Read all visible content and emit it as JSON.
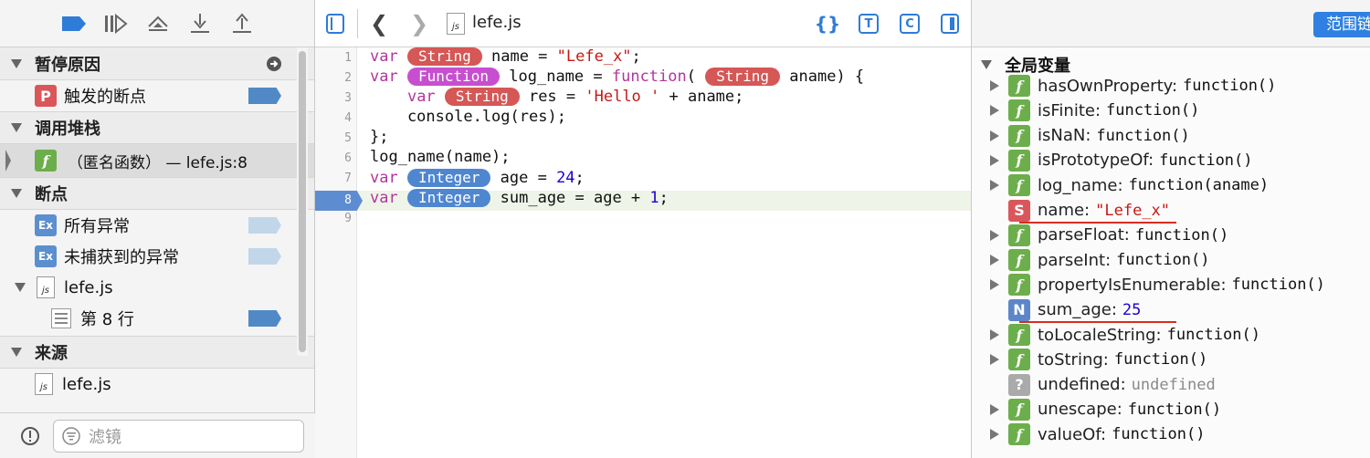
{
  "sidebar": {
    "sections": {
      "pause_reason": "暂停原因",
      "call_stack": "调用堆栈",
      "breakpoints": "断点",
      "sources": "来源"
    },
    "pause_item": {
      "badge": "P",
      "label": "触发的断点"
    },
    "stack_item": {
      "badge": "f",
      "label": "（匿名函数） — lefe.js:8"
    },
    "breakpoint_items": [
      {
        "badge": "Ex",
        "label": "所有异常"
      },
      {
        "badge": "Ex",
        "label": "未捕获到的异常"
      }
    ],
    "bp_file": {
      "icon": "js",
      "label": "lefe.js"
    },
    "bp_line": "第 8 行",
    "source_file": {
      "icon": "js",
      "label": "lefe.js"
    },
    "filter_placeholder": "滤镜"
  },
  "editor": {
    "file_icon": "js",
    "file_name": "lefe.js",
    "toolbar_icons": [
      "{}",
      "T",
      "C"
    ],
    "line_numbers": [
      "1",
      "2",
      "3",
      "4",
      "5",
      "6",
      "7",
      "8",
      "9"
    ],
    "active_line": "8",
    "tokens": {
      "var": "var",
      "function_kw": "function",
      "type_string": "String",
      "type_function": "Function",
      "type_integer": "Integer",
      "l1_rest": " name = ",
      "l1_str": "\"Lefe_x\"",
      "l1_end": ";",
      "l2_a": " log_name = ",
      "l2_b": "( ",
      "l2_c": " aname) {",
      "l3_indent": "    ",
      "l3_rest": " res = ",
      "l3_str": "'Hello '",
      "l3_end": " + aname;",
      "l4": "    console.log(res);",
      "l5": "};",
      "l6": "log_name(name);",
      "l7_rest": " age = ",
      "l7_num": "24",
      "l8_rest": " sum_age = age + ",
      "l8_num": "1",
      "semi": ";"
    }
  },
  "scope": {
    "button": "范围链",
    "section": "全局变量",
    "vars": [
      {
        "badge": "f",
        "name": "hasOwnProperty:",
        "value": "function()",
        "kind": "fn",
        "expandable": true
      },
      {
        "badge": "f",
        "name": "isFinite:",
        "value": "function()",
        "kind": "fn",
        "expandable": true
      },
      {
        "badge": "f",
        "name": "isNaN:",
        "value": "function()",
        "kind": "fn",
        "expandable": true
      },
      {
        "badge": "f",
        "name": "isPrototypeOf:",
        "value": "function()",
        "kind": "fn",
        "expandable": true
      },
      {
        "badge": "f",
        "name": "log_name:",
        "value": "function(aname)",
        "kind": "fn",
        "expandable": true
      },
      {
        "badge": "S",
        "name": "name:",
        "value": "\"Lefe_x\"",
        "kind": "str",
        "expandable": false
      },
      {
        "badge": "f",
        "name": "parseFloat:",
        "value": "function()",
        "kind": "fn",
        "expandable": true
      },
      {
        "badge": "f",
        "name": "parseInt:",
        "value": "function()",
        "kind": "fn",
        "expandable": true
      },
      {
        "badge": "f",
        "name": "propertyIsEnumerable:",
        "value": "function()",
        "kind": "fn",
        "expandable": true
      },
      {
        "badge": "N",
        "name": "sum_age:",
        "value": "25",
        "kind": "num",
        "expandable": false
      },
      {
        "badge": "f",
        "name": "toLocaleString:",
        "value": "function()",
        "kind": "fn",
        "expandable": true
      },
      {
        "badge": "f",
        "name": "toString:",
        "value": "function()",
        "kind": "fn",
        "expandable": true
      },
      {
        "badge": "?",
        "name": "undefined:",
        "value": "undefined",
        "kind": "undef",
        "expandable": false
      },
      {
        "badge": "f",
        "name": "unescape:",
        "value": "function()",
        "kind": "fn",
        "expandable": true
      },
      {
        "badge": "f",
        "name": "valueOf:",
        "value": "function()",
        "kind": "fn",
        "expandable": true
      }
    ]
  }
}
